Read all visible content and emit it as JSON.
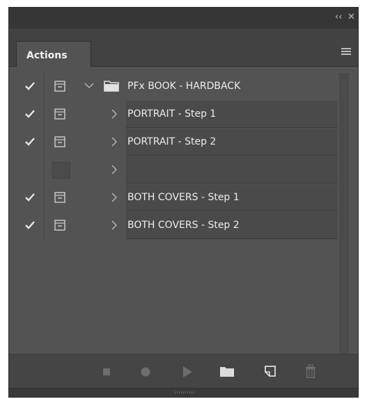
{
  "panel": {
    "tab_label": "Actions",
    "title_controls": {
      "collapse": "‹‹",
      "close": "✕"
    }
  },
  "actions": [
    {
      "checked": true,
      "dialog": true,
      "expanded": true,
      "type": "set",
      "name": "PFx BOOK - HARDBACK"
    },
    {
      "checked": true,
      "dialog": true,
      "expanded": false,
      "type": "action",
      "name": "PORTRAIT - Step 1"
    },
    {
      "checked": true,
      "dialog": true,
      "expanded": false,
      "type": "action",
      "name": "PORTRAIT - Step 2"
    },
    {
      "checked": false,
      "dialog": false,
      "expanded": false,
      "type": "action",
      "name": ""
    },
    {
      "checked": true,
      "dialog": true,
      "expanded": false,
      "type": "action",
      "name": "BOTH COVERS - Step 1"
    },
    {
      "checked": true,
      "dialog": true,
      "expanded": false,
      "type": "action",
      "name": "BOTH COVERS - Step 2"
    }
  ],
  "toolbar": [
    "stop-icon",
    "record-icon",
    "play-icon",
    "new-set-icon",
    "new-action-icon",
    "delete-icon"
  ],
  "colors": {
    "panel": "#535353",
    "titlebar": "#363636",
    "row": "#4a4a4a",
    "text": "#ececec"
  }
}
